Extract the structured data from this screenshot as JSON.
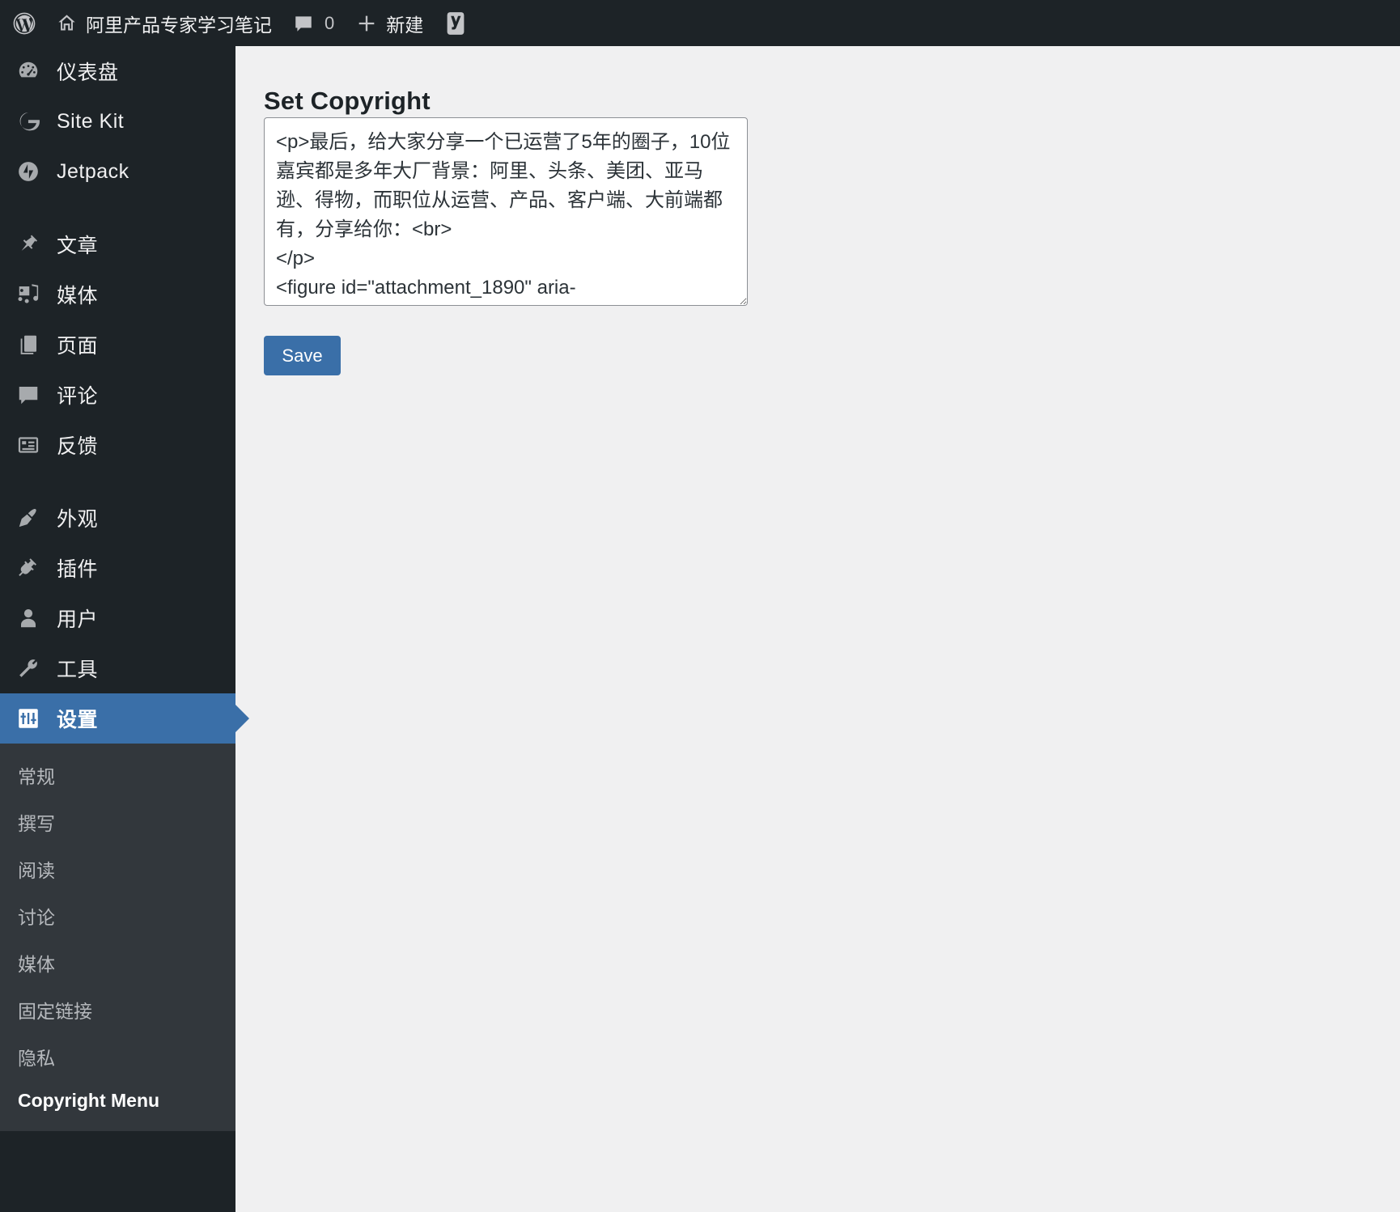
{
  "adminbar": {
    "wp_logo_icon": "wordpress-logo-icon",
    "home_icon": "home-icon",
    "site_name": "阿里产品专家学习笔记",
    "comments_icon": "comment-bubble-icon",
    "comments_count": "0",
    "new_icon": "plus-icon",
    "new_label": "新建",
    "yoast_icon": "yoast-seo-logo-icon"
  },
  "sidebar": {
    "items": [
      {
        "label": "仪表盘",
        "icon": "dashboard-icon",
        "current": false,
        "sep_after": false
      },
      {
        "label": "Site Kit",
        "icon": "google-site-kit-icon",
        "current": false,
        "sep_after": false
      },
      {
        "label": "Jetpack",
        "icon": "jetpack-icon",
        "current": false,
        "sep_after": true
      },
      {
        "label": "文章",
        "icon": "pin-icon",
        "current": false,
        "sep_after": false
      },
      {
        "label": "媒体",
        "icon": "media-icon",
        "current": false,
        "sep_after": false
      },
      {
        "label": "页面",
        "icon": "pages-icon",
        "current": false,
        "sep_after": false
      },
      {
        "label": "评论",
        "icon": "comment-bubble-icon",
        "current": false,
        "sep_after": false
      },
      {
        "label": "反馈",
        "icon": "feedback-icon",
        "current": false,
        "sep_after": true
      },
      {
        "label": "外观",
        "icon": "paintbrush-icon",
        "current": false,
        "sep_after": false
      },
      {
        "label": "插件",
        "icon": "plugin-icon",
        "current": false,
        "sep_after": false
      },
      {
        "label": "用户",
        "icon": "user-icon",
        "current": false,
        "sep_after": false
      },
      {
        "label": "工具",
        "icon": "wrench-icon",
        "current": false,
        "sep_after": false
      },
      {
        "label": "设置",
        "icon": "settings-sliders-icon",
        "current": true,
        "sep_after": false
      }
    ],
    "submenu": [
      {
        "label": "常规",
        "current": false
      },
      {
        "label": "撰写",
        "current": false
      },
      {
        "label": "阅读",
        "current": false
      },
      {
        "label": "讨论",
        "current": false
      },
      {
        "label": "媒体",
        "current": false
      },
      {
        "label": "固定链接",
        "current": false
      },
      {
        "label": "隐私",
        "current": false
      },
      {
        "label": "Copyright Menu",
        "current": true
      }
    ]
  },
  "main": {
    "page_title": "Set Copyright",
    "textarea_value": "<p>最后，给大家分享一个已运营了5年的圈子，10位嘉宾都是多年大厂背景：阿里、头条、美团、亚马逊、得物，而职位从运营、产品、客户端、大前端都有，分享给你：<br>\n</p>\n<figure id=\"attachment_1890\" aria-",
    "save_label": "Save"
  },
  "colors": {
    "accent": "#3a6fa8",
    "sidebar_bg": "#1d2327",
    "submenu_bg": "#32373c",
    "content_bg": "#f0f0f1"
  }
}
